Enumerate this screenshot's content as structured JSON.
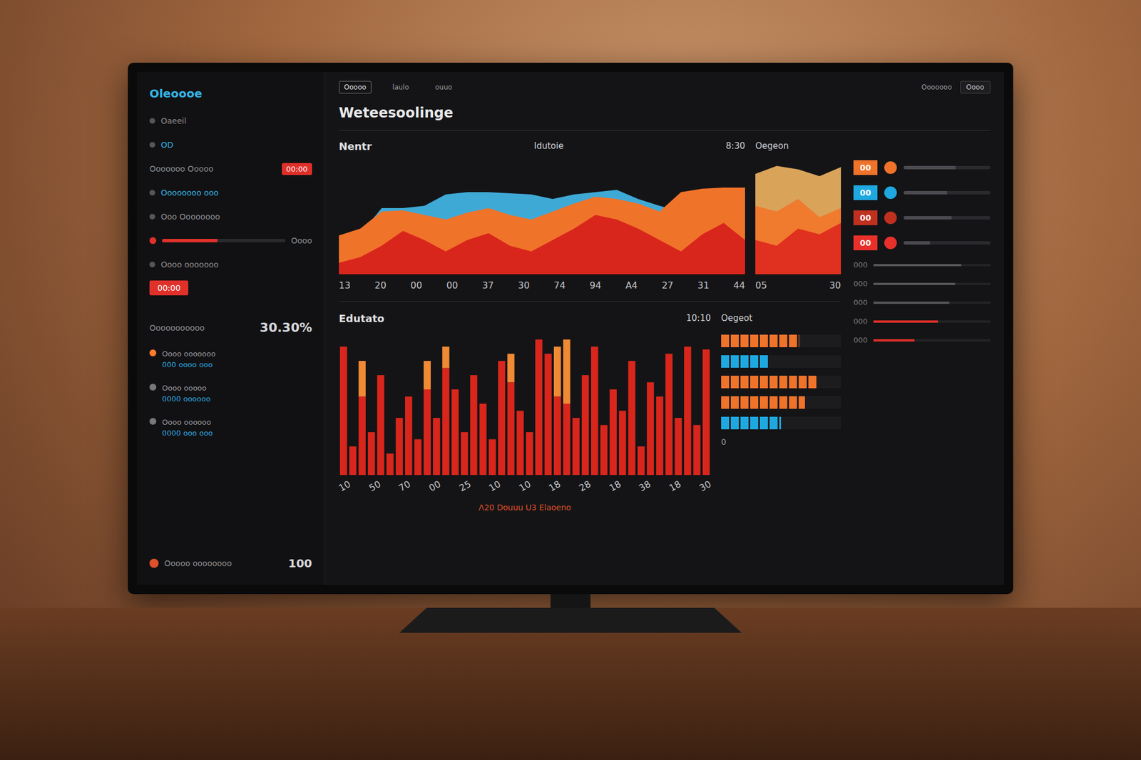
{
  "window": {
    "title": "Weteesoolinge"
  },
  "tabs": [
    {
      "label": "Ooooo",
      "selected": true
    },
    {
      "label": "laulo",
      "selected": false
    },
    {
      "label": "ouuo",
      "selected": false
    }
  ],
  "header_right": {
    "label": "Ooooooo",
    "button": "Oooo"
  },
  "sidebar": {
    "brand": "Oleoooe",
    "items": [
      {
        "kind": "text",
        "label": "Oaeeil",
        "color": "#8d8d92"
      },
      {
        "kind": "text",
        "label": "OD",
        "color": "#36b4e6"
      },
      {
        "kind": "badge",
        "label": "Ooooooo Ooooo",
        "badge": "00:00",
        "color": "#e0302a"
      },
      {
        "kind": "text",
        "label": "Oooooooo ooo",
        "color": "#36b4e6"
      },
      {
        "kind": "text",
        "label": "Ooo Oooooooo",
        "color": "#8d8d92"
      },
      {
        "kind": "progress",
        "label": "Oooo",
        "level": 0.45,
        "color": "#e0302a"
      },
      {
        "kind": "text",
        "label": "Oooo ooooooo",
        "color": "#8d8d92"
      },
      {
        "kind": "button",
        "label": "00:00",
        "color": "#e0302a"
      }
    ],
    "stat": {
      "label": "Ooooooooooo",
      "value": "30.30%"
    },
    "alerts": [
      {
        "title": "Oooo ooooooo",
        "detail": "000 oooo ooo",
        "color": "#ff7a2e"
      },
      {
        "title": "Oooo ooooo",
        "detail": "0000 oooooo",
        "color": "#77777c"
      },
      {
        "title": "Oooo oooooo",
        "detail": "0000 ooo ooo",
        "color": "#77777c"
      }
    ],
    "footer": {
      "label": "Ooooo oooooooo",
      "value": "100",
      "color": "#e0502a"
    }
  },
  "top_chart": {
    "title": "Nentr",
    "subtitle": "Idutoie",
    "time": "8:30",
    "x_ticks": [
      "13",
      "20",
      "00",
      "00",
      "37",
      "30",
      "74",
      "94",
      "A4",
      "27",
      "31",
      "44"
    ],
    "series": [
      {
        "name": "blue",
        "color": "#3fa9d6",
        "values": [
          30,
          35,
          58,
          58,
          60,
          70,
          72,
          72,
          71,
          70,
          66,
          70,
          72,
          74,
          66,
          60,
          55,
          60,
          65,
          70
        ]
      },
      {
        "name": "orange",
        "color": "#f0732a",
        "values": [
          34,
          40,
          55,
          56,
          52,
          48,
          54,
          58,
          52,
          48,
          55,
          62,
          68,
          66,
          62,
          55,
          72,
          75,
          76,
          76
        ]
      },
      {
        "name": "red",
        "color": "#d9261c",
        "values": [
          10,
          15,
          25,
          38,
          30,
          20,
          30,
          36,
          25,
          20,
          30,
          40,
          52,
          48,
          40,
          30,
          20,
          35,
          45,
          30
        ]
      }
    ]
  },
  "side_chart": {
    "title": "Oegeon",
    "x_ticks": [
      "05",
      "30"
    ],
    "series": [
      {
        "name": "yellow",
        "color": "#d9a35a",
        "values": [
          88,
          95,
          92,
          86,
          94
        ]
      },
      {
        "name": "orange",
        "color": "#f07a2e",
        "values": [
          60,
          55,
          66,
          50,
          58
        ]
      },
      {
        "name": "red",
        "color": "#e0301f",
        "values": [
          30,
          25,
          40,
          35,
          45
        ]
      }
    ]
  },
  "bar_chart": {
    "title": "Edutato",
    "time": "10:10",
    "x_ticks": [
      "10",
      "50",
      "70",
      "00",
      "25",
      "10",
      "10",
      "18",
      "28",
      "18",
      "38",
      "18",
      "30"
    ],
    "series": [
      {
        "name": "red",
        "color": "#d9261c",
        "values": [
          90,
          20,
          55,
          30,
          70,
          15,
          40,
          55,
          25,
          60,
          40,
          75,
          60,
          30,
          70,
          50,
          25,
          80,
          65,
          45,
          30,
          95,
          85,
          55,
          50,
          40,
          70,
          90,
          35,
          60,
          45,
          80,
          20,
          65,
          55,
          85,
          40,
          90,
          35,
          88
        ]
      },
      {
        "name": "orange",
        "color": "#f08a34",
        "values": [
          0,
          0,
          25,
          0,
          0,
          0,
          0,
          0,
          0,
          20,
          0,
          15,
          0,
          0,
          0,
          0,
          0,
          0,
          20,
          0,
          0,
          0,
          0,
          35,
          45,
          0,
          0,
          0,
          0,
          0,
          0,
          0,
          0,
          0,
          0,
          0,
          0,
          0,
          0,
          0
        ]
      }
    ],
    "caption": "Λ20 Douuu U3 Elaoeno"
  },
  "breakdown": {
    "title": "Oegeot",
    "footer": "0",
    "rows": [
      {
        "color": "#f0732a",
        "level": 0.65
      },
      {
        "color": "#1ea8e0",
        "level": 0.4
      },
      {
        "color": "#f0732a",
        "level": 0.8
      },
      {
        "color": "#f0732a",
        "level": 0.7
      },
      {
        "color": "#1ea8e0",
        "level": 0.5
      }
    ]
  },
  "right_panel": {
    "rows": [
      {
        "badge": "00",
        "color": "#f0732a",
        "level": 0.6
      },
      {
        "badge": "00",
        "color": "#1ea8e0",
        "level": 0.5
      },
      {
        "badge": "00",
        "color": "#c0301f",
        "level": 0.55
      },
      {
        "badge": "00",
        "color": "#e8302a",
        "level": 0.3
      }
    ],
    "lines": [
      {
        "label": "000",
        "color": "#55555a",
        "level": 0.75
      },
      {
        "label": "000",
        "color": "#55555a",
        "level": 0.7
      },
      {
        "label": "000",
        "color": "#55555a",
        "level": 0.65
      },
      {
        "label": "000",
        "color": "#e0302a",
        "level": 0.55
      },
      {
        "label": "000",
        "color": "#e0302a",
        "level": 0.35
      }
    ]
  }
}
